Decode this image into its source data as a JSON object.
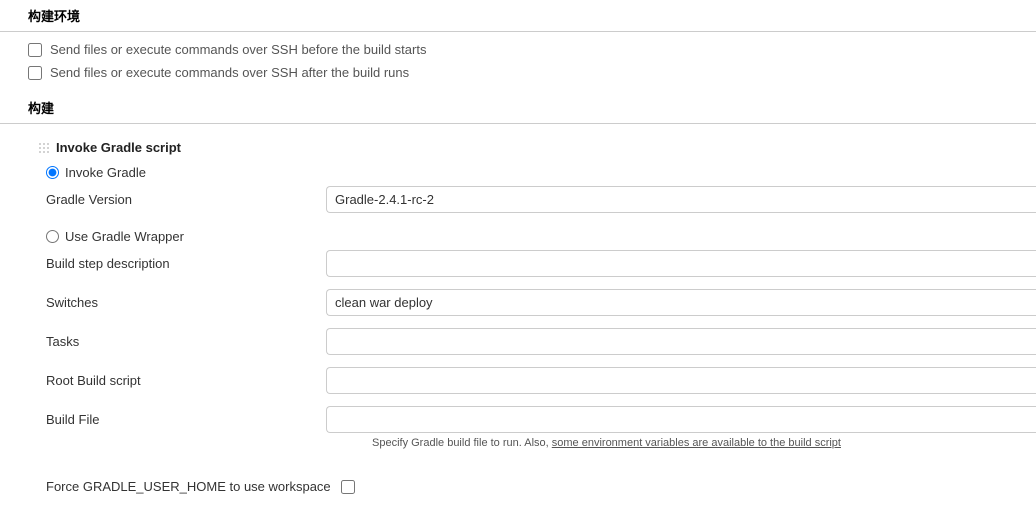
{
  "buildEnv": {
    "title": "构建环境",
    "sshBeforeLabel": "Send files or execute commands over SSH before the build starts",
    "sshAfterLabel": "Send files or execute commands over SSH after the build runs"
  },
  "build": {
    "title": "构建",
    "invokeTitle": "Invoke Gradle script",
    "radios": {
      "invokeGradleLabel": "Invoke Gradle",
      "useWrapperLabel": "Use Gradle Wrapper"
    },
    "fields": {
      "gradleVersionLabel": "Gradle Version",
      "gradleVersionValue": "Gradle-2.4.1-rc-2",
      "buildStepDescLabel": "Build step description",
      "buildStepDescValue": "",
      "switchesLabel": "Switches",
      "switchesValue": "clean war deploy",
      "tasksLabel": "Tasks",
      "tasksValue": "",
      "rootBuildScriptLabel": "Root Build script",
      "rootBuildScriptValue": "",
      "buildFileLabel": "Build File",
      "buildFileValue": ""
    },
    "help": {
      "prefix": "Specify Gradle build file to run. Also, ",
      "linkText": "some environment variables are available to the build script"
    },
    "forceHomeLabel": "Force GRADLE_USER_HOME to use workspace"
  }
}
